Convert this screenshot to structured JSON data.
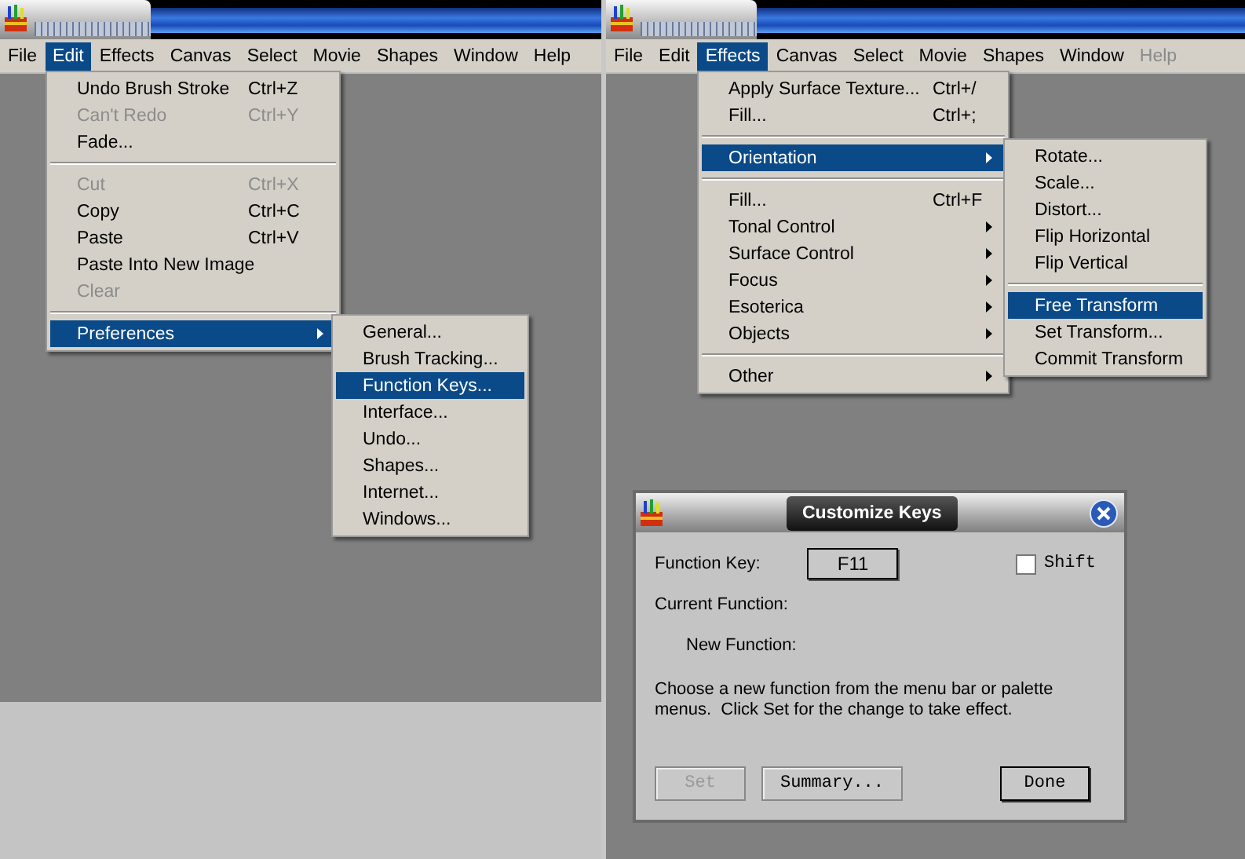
{
  "windows": [
    {
      "menubar": [
        {
          "label": "File",
          "selected": false,
          "disabled": false
        },
        {
          "label": "Edit",
          "selected": true,
          "disabled": false
        },
        {
          "label": "Effects",
          "selected": false,
          "disabled": false
        },
        {
          "label": "Canvas",
          "selected": false,
          "disabled": false
        },
        {
          "label": "Select",
          "selected": false,
          "disabled": false
        },
        {
          "label": "Movie",
          "selected": false,
          "disabled": false
        },
        {
          "label": "Shapes",
          "selected": false,
          "disabled": false
        },
        {
          "label": "Window",
          "selected": false,
          "disabled": false
        },
        {
          "label": "Help",
          "selected": false,
          "disabled": false
        }
      ],
      "menu": [
        {
          "kind": "item",
          "label": "Undo Brush Stroke",
          "shortcut": "Ctrl+Z",
          "disabled": false,
          "selected": false,
          "submenu": false
        },
        {
          "kind": "item",
          "label": "Can't Redo",
          "shortcut": "Ctrl+Y",
          "disabled": true,
          "selected": false,
          "submenu": false
        },
        {
          "kind": "item",
          "label": "Fade...",
          "disabled": false,
          "selected": false,
          "submenu": false
        },
        {
          "kind": "separator"
        },
        {
          "kind": "item",
          "label": "Cut",
          "shortcut": "Ctrl+X",
          "disabled": true,
          "selected": false,
          "submenu": false
        },
        {
          "kind": "item",
          "label": "Copy",
          "shortcut": "Ctrl+C",
          "disabled": false,
          "selected": false,
          "submenu": false
        },
        {
          "kind": "item",
          "label": "Paste",
          "shortcut": "Ctrl+V",
          "disabled": false,
          "selected": false,
          "submenu": false
        },
        {
          "kind": "item",
          "label": "Paste Into New Image",
          "disabled": false,
          "selected": false,
          "submenu": false
        },
        {
          "kind": "item",
          "label": "Clear",
          "disabled": true,
          "selected": false,
          "submenu": false
        },
        {
          "kind": "separator"
        },
        {
          "kind": "item",
          "label": "Preferences",
          "disabled": false,
          "selected": true,
          "submenu": true
        }
      ],
      "submenu": [
        {
          "kind": "item",
          "label": "General...",
          "disabled": false,
          "selected": false,
          "submenu": false
        },
        {
          "kind": "item",
          "label": "Brush Tracking...",
          "disabled": false,
          "selected": false,
          "submenu": false
        },
        {
          "kind": "item",
          "label": "Function Keys...",
          "disabled": false,
          "selected": true,
          "submenu": false
        },
        {
          "kind": "item",
          "label": "Interface...",
          "disabled": false,
          "selected": false,
          "submenu": false
        },
        {
          "kind": "item",
          "label": "Undo...",
          "disabled": false,
          "selected": false,
          "submenu": false
        },
        {
          "kind": "item",
          "label": "Shapes...",
          "disabled": false,
          "selected": false,
          "submenu": false
        },
        {
          "kind": "item",
          "label": "Internet...",
          "disabled": false,
          "selected": false,
          "submenu": false
        },
        {
          "kind": "item",
          "label": "Windows...",
          "disabled": false,
          "selected": false,
          "submenu": false
        }
      ]
    },
    {
      "menubar": [
        {
          "label": "File",
          "selected": false,
          "disabled": false
        },
        {
          "label": "Edit",
          "selected": false,
          "disabled": false
        },
        {
          "label": "Effects",
          "selected": true,
          "disabled": false
        },
        {
          "label": "Canvas",
          "selected": false,
          "disabled": false
        },
        {
          "label": "Select",
          "selected": false,
          "disabled": false
        },
        {
          "label": "Movie",
          "selected": false,
          "disabled": false
        },
        {
          "label": "Shapes",
          "selected": false,
          "disabled": false
        },
        {
          "label": "Window",
          "selected": false,
          "disabled": false
        },
        {
          "label": "Help",
          "selected": false,
          "disabled": true
        }
      ],
      "menu": [
        {
          "kind": "item",
          "label": "Apply Surface Texture...",
          "shortcut": "Ctrl+/",
          "disabled": false,
          "selected": false,
          "submenu": false
        },
        {
          "kind": "item",
          "label": "Fill...",
          "shortcut": "Ctrl+;",
          "disabled": false,
          "selected": false,
          "submenu": false
        },
        {
          "kind": "separator"
        },
        {
          "kind": "item",
          "label": "Orientation",
          "disabled": false,
          "selected": true,
          "submenu": true
        },
        {
          "kind": "separator"
        },
        {
          "kind": "item",
          "label": "Fill...",
          "shortcut": "Ctrl+F",
          "disabled": false,
          "selected": false,
          "submenu": false
        },
        {
          "kind": "item",
          "label": "Tonal Control",
          "disabled": false,
          "selected": false,
          "submenu": true
        },
        {
          "kind": "item",
          "label": "Surface Control",
          "disabled": false,
          "selected": false,
          "submenu": true
        },
        {
          "kind": "item",
          "label": "Focus",
          "disabled": false,
          "selected": false,
          "submenu": true
        },
        {
          "kind": "item",
          "label": "Esoterica",
          "disabled": false,
          "selected": false,
          "submenu": true
        },
        {
          "kind": "item",
          "label": "Objects",
          "disabled": false,
          "selected": false,
          "submenu": true
        },
        {
          "kind": "separator"
        },
        {
          "kind": "item",
          "label": "Other",
          "disabled": false,
          "selected": false,
          "submenu": true
        }
      ],
      "submenu": [
        {
          "kind": "item",
          "label": "Rotate...",
          "disabled": false,
          "selected": false,
          "submenu": false
        },
        {
          "kind": "item",
          "label": "Scale...",
          "disabled": false,
          "selected": false,
          "submenu": false
        },
        {
          "kind": "item",
          "label": "Distort...",
          "disabled": false,
          "selected": false,
          "submenu": false
        },
        {
          "kind": "item",
          "label": "Flip Horizontal",
          "disabled": false,
          "selected": false,
          "submenu": false
        },
        {
          "kind": "item",
          "label": "Flip Vertical",
          "disabled": false,
          "selected": false,
          "submenu": false
        },
        {
          "kind": "separator"
        },
        {
          "kind": "item",
          "label": "Free Transform",
          "disabled": false,
          "selected": true,
          "submenu": false
        },
        {
          "kind": "item",
          "label": "Set Transform...",
          "disabled": false,
          "selected": false,
          "submenu": false
        },
        {
          "kind": "item",
          "label": "Commit Transform",
          "disabled": false,
          "selected": false,
          "submenu": false
        }
      ]
    }
  ],
  "dialog": {
    "title": "Customize Keys",
    "function_key_label": "Function Key:",
    "function_key": "F11",
    "shift": {
      "label": "Shift",
      "checked": false
    },
    "current_function_label": "Current Function:",
    "new_function_label": "New Function:",
    "instructions": "Choose a new function from the menu bar or palette menus.  Click Set for the change to take effect.",
    "buttons": [
      {
        "label": "Set",
        "disabled": true,
        "default": false
      },
      {
        "label": "Summary...",
        "disabled": false,
        "default": false
      },
      {
        "label": "Done",
        "disabled": false,
        "default": true
      }
    ]
  }
}
